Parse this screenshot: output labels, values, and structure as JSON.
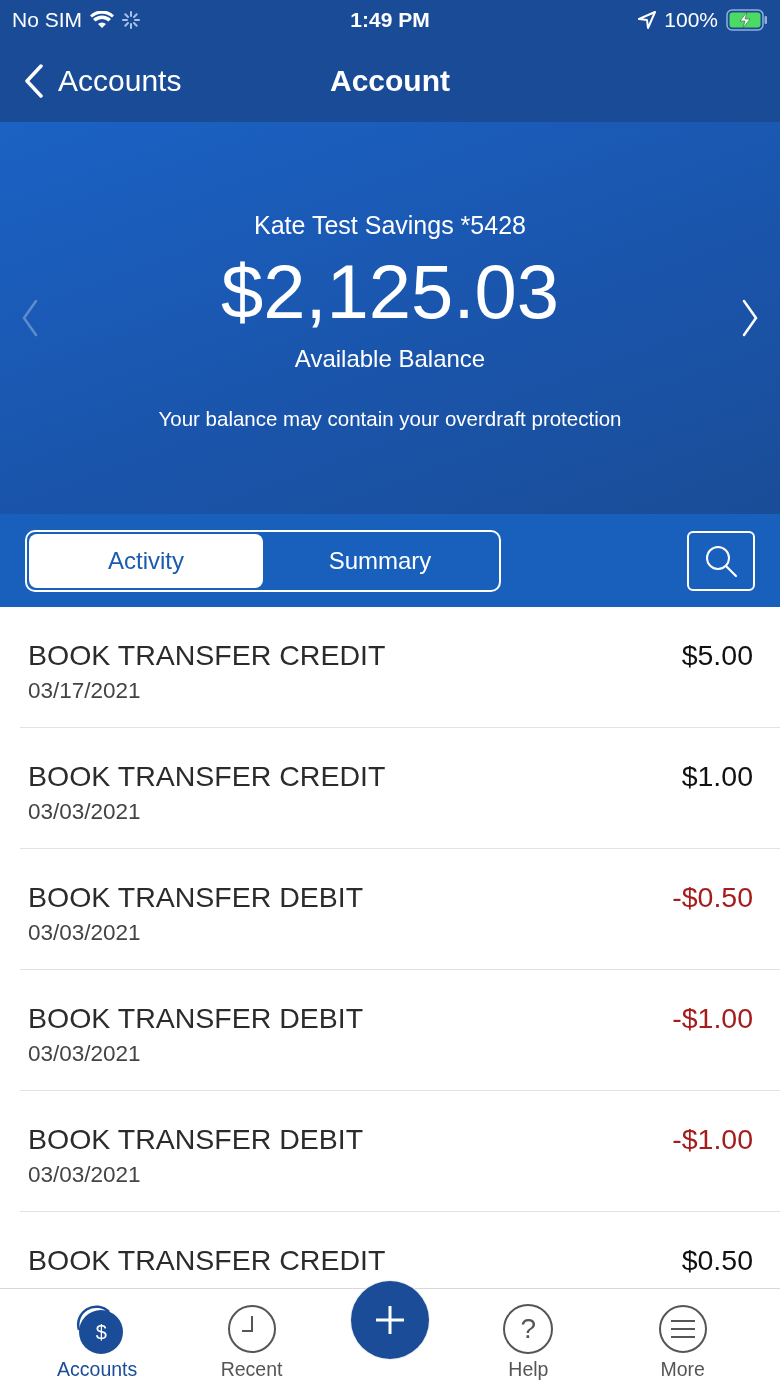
{
  "status_bar": {
    "carrier": "No SIM",
    "time": "1:49 PM",
    "battery": "100%"
  },
  "nav": {
    "back": "Accounts",
    "title": "Account"
  },
  "account": {
    "name": "Kate Test Savings *5428",
    "balance": "$2,125.03",
    "balance_label": "Available Balance",
    "note": "Your balance may contain your overdraft protection",
    "prev_enabled": false,
    "next_enabled": true
  },
  "segments": [
    {
      "label": "Activity",
      "selected": true
    },
    {
      "label": "Summary",
      "selected": false
    }
  ],
  "transactions": [
    {
      "title": "BOOK TRANSFER CREDIT",
      "date": "03/17/2021",
      "amount": "$5.00",
      "kind": "credit"
    },
    {
      "title": "BOOK TRANSFER CREDIT",
      "date": "03/03/2021",
      "amount": "$1.00",
      "kind": "credit"
    },
    {
      "title": "BOOK TRANSFER DEBIT",
      "date": "03/03/2021",
      "amount": "-$0.50",
      "kind": "debit"
    },
    {
      "title": "BOOK TRANSFER DEBIT",
      "date": "03/03/2021",
      "amount": "-$1.00",
      "kind": "debit"
    },
    {
      "title": "BOOK TRANSFER DEBIT",
      "date": "03/03/2021",
      "amount": "-$1.00",
      "kind": "debit"
    },
    {
      "title": "BOOK TRANSFER CREDIT",
      "amount": "$0.50",
      "kind": "credit"
    }
  ],
  "tab_bar": [
    {
      "kind": "accounts",
      "symbol": "$",
      "label": "Accounts",
      "selected": true
    },
    {
      "kind": "recent",
      "label": "Recent",
      "selected": false
    },
    {
      "kind": "add",
      "selected": false
    },
    {
      "kind": "help",
      "symbol": "?",
      "label": "Help",
      "selected": false
    },
    {
      "kind": "more",
      "label": "More",
      "selected": false
    }
  ]
}
